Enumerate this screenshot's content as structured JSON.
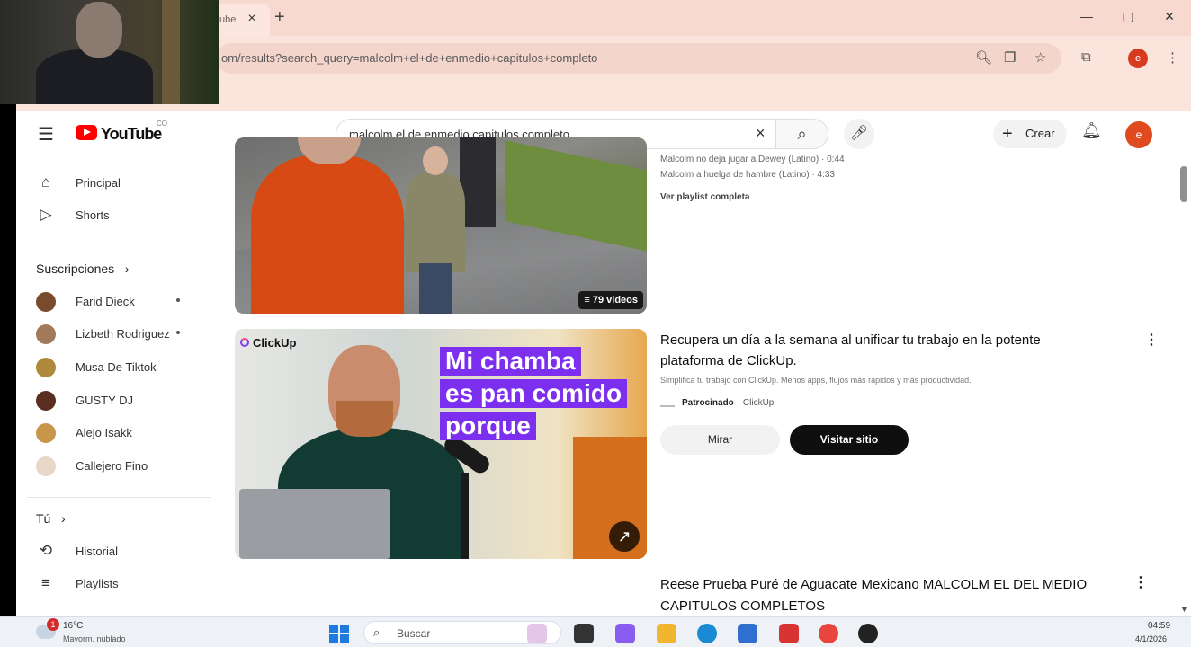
{
  "browser": {
    "tab_title": "ube",
    "tab_close": "×",
    "new_tab": "+",
    "url": "om/results?search_query=malcolm+el+de+enmedio+capitulos+completo",
    "window_controls": {
      "minimize": "—",
      "maximize": "▢",
      "close": "✕"
    },
    "icons": [
      "zoom-icon",
      "cast-icon",
      "bookmark-star-icon",
      "extensions-icon",
      "profile-icon",
      "menu-icon"
    ],
    "profile_initial": "e"
  },
  "youtube": {
    "logo_text": "YouTube",
    "country_code": "CO",
    "search": {
      "query": "malcolm el de enmedio capitulos completo",
      "clear": "×"
    },
    "create_label": "Crear",
    "avatar_initial": "e",
    "accent_color": "#ff0000"
  },
  "sidebar": {
    "main": [
      {
        "label": "Principal",
        "icon": "home-icon"
      },
      {
        "label": "Shorts",
        "icon": "shorts-icon"
      }
    ],
    "subscriptions_title": "Suscripciones",
    "subscriptions": [
      {
        "label": "Farid Dieck",
        "dot": true
      },
      {
        "label": "Lizbeth Rodriguez",
        "dot": true
      },
      {
        "label": "Musa De Tiktok",
        "dot": false
      },
      {
        "label": "GUSTY DJ",
        "dot": false
      },
      {
        "label": "Alejo Isakk",
        "dot": false
      },
      {
        "label": "Callejero Fino",
        "dot": false
      }
    ],
    "you_title": "Tú",
    "you_items": [
      {
        "label": "Historial",
        "icon": "history-icon"
      },
      {
        "label": "Playlists",
        "icon": "playlists-icon"
      }
    ]
  },
  "results": {
    "playlist": {
      "badge": "79 videos",
      "lines": [
        "Malcolm no deja jugar a Dewey (Latino) · 0:44",
        "Malcolm a huelga de hambre (Latino) · 4:33"
      ],
      "link": "Ver playlist completa"
    },
    "ad": {
      "brand": "ClickUp",
      "promo_lines": [
        "Mi chamba",
        "es pan comido",
        "porque"
      ],
      "title": "Recupera un día a la semana al unificar tu trabajo en la potente plataforma de ClickUp.",
      "description": "Simplifica tu trabajo con ClickUp. Menos apps, flujos más rápidos y más productividad.",
      "sponsored": "Patrocinado",
      "advertiser": "· ClickUp",
      "watch_label": "Mirar",
      "visit_label": "Visitar sitio",
      "promo_color": "#7d2ff0"
    },
    "video3": {
      "title": "Reese Prueba Puré de Aguacate Mexicano MALCOLM EL DEL MEDIO CAPITULOS COMPLETOS"
    }
  },
  "taskbar": {
    "weather_badge": "1",
    "temperature": "16°C",
    "weather_desc": "Mayorm. nublado",
    "search_placeholder": "Buscar",
    "time": "04:59",
    "date": "4/1/2026"
  }
}
